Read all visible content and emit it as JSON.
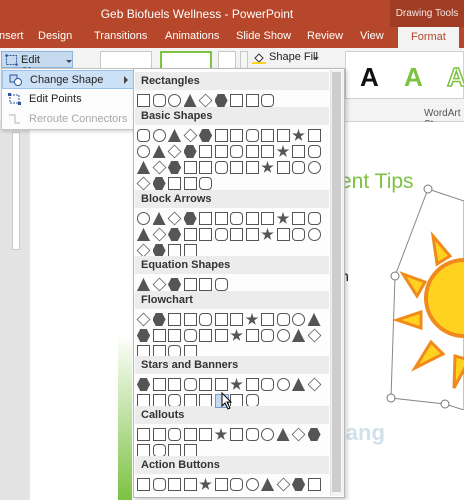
{
  "window": {
    "title": "Geb Biofuels Wellness - PowerPoint",
    "contextual_tab_group": "Drawing Tools"
  },
  "tabs": [
    {
      "label": "nsert",
      "active": false
    },
    {
      "label": "Design",
      "active": false
    },
    {
      "label": "Transitions",
      "active": false
    },
    {
      "label": "Animations",
      "active": false
    },
    {
      "label": "Slide Show",
      "active": false
    },
    {
      "label": "Review",
      "active": false
    },
    {
      "label": "View",
      "active": false
    },
    {
      "label": "Format",
      "active": true
    }
  ],
  "ribbon": {
    "edit_shape_label": "Edit Shape",
    "shape_fill_label": "Shape Fill",
    "wordart_letters": [
      "A",
      "A",
      "A"
    ],
    "wordart_group_label": "WordArt St"
  },
  "edit_shape_menu": {
    "items": [
      {
        "label": "Change Shape",
        "has_submenu": true,
        "highlighted": true,
        "enabled": true
      },
      {
        "label": "Edit Points",
        "has_submenu": false,
        "highlighted": false,
        "enabled": true
      },
      {
        "label": "Reroute Connectors",
        "has_submenu": false,
        "highlighted": false,
        "enabled": false
      }
    ]
  },
  "gallery": {
    "sections": [
      {
        "title": "Rectangles",
        "rows": [
          9
        ]
      },
      {
        "title": "Basic Shapes",
        "rows": [
          12,
          12,
          12,
          5
        ]
      },
      {
        "title": "Block Arrows",
        "rows": [
          12,
          12,
          4
        ]
      },
      {
        "title": "Equation Shapes",
        "rows": [
          6
        ]
      },
      {
        "title": "Flowchart",
        "rows": [
          12,
          12,
          4
        ]
      },
      {
        "title": "Stars and Banners",
        "rows": [
          12,
          8
        ]
      },
      {
        "title": "Callouts",
        "rows": [
          12,
          4
        ]
      },
      {
        "title": "Action Buttons",
        "rows": [
          12
        ]
      }
    ]
  },
  "slide": {
    "title_fragment": "ent Tips",
    "text_fragment": "n",
    "watermark": "Quantrimang"
  },
  "colors": {
    "ppt_red": "#b7472a",
    "accent_green": "#7dc242",
    "menu_highlight": "#cde1f6",
    "sun_yellow": "#ffd21f",
    "sun_outline": "#f08a1c"
  }
}
